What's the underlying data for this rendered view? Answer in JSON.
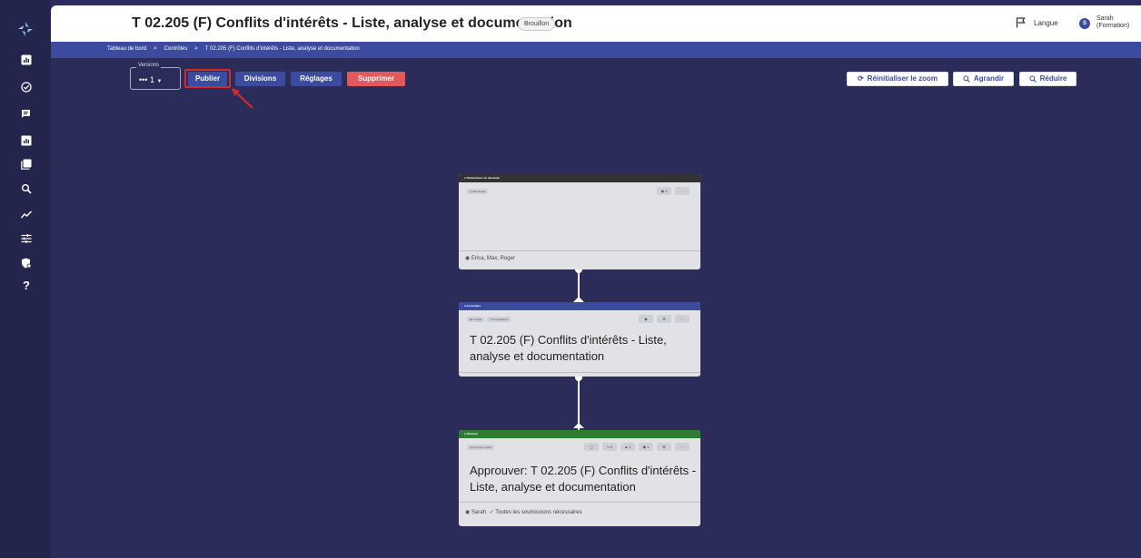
{
  "header": {
    "title": "T 02.205 (F) Conflits d'intérêts - Liste, analyse et documentation",
    "status_badge": "Brouillon",
    "language_label": "Langue",
    "user_initial": "S",
    "user_name": "Sarah",
    "user_role": "(Formation)"
  },
  "breadcrumb": {
    "items": [
      "Tableau de bord",
      "Contrôles",
      "T 02.205 (F) Conflits d'intérêts - Liste, analyse et documentation"
    ],
    "separator": ">"
  },
  "toolbar": {
    "versions_label": "Versions",
    "version_value": "1",
    "publish_label": "Publier",
    "divisions_label": "Divisions",
    "settings_label": "Réglages",
    "delete_label": "Supprimer",
    "reset_zoom_label": "Réinitialiser le zoom",
    "zoom_in_label": "Agrandir",
    "zoom_out_label": "Réduire"
  },
  "sidebar": {
    "icons": [
      "dashboard-icon",
      "check-circle-icon",
      "chat-icon",
      "report-icon",
      "library-icon",
      "search-icon",
      "trend-icon",
      "sliders-icon",
      "shield-icon",
      "help-icon"
    ]
  },
  "workflow": {
    "node1": {
      "header": "Déclencheur de demande",
      "tag": "Demander",
      "count": "3",
      "more": "···",
      "footer": "Erica, Max, Roger"
    },
    "node2": {
      "header": "Formulaire",
      "tag1": "1 Page",
      "tag2": "11 Questions",
      "more": "···",
      "title": "T 02.205 (F) Conflits d'intérêts - Liste, analyse et documentation"
    },
    "node3": {
      "header": "Décision",
      "tag": "Peut être rejeté",
      "count_a": "0",
      "count_b": "1",
      "count_c": "1",
      "more": "···",
      "title": "Approuver: T 02.205 (F) Conflits d'intérêts - Liste, analyse et documentation",
      "footer_user": "Sarah",
      "footer_note": "Toutes les soumissions nécessaires"
    }
  },
  "colors": {
    "canvas": "#2b2c5a",
    "sidebar": "#24254d",
    "accent_blue": "#3a4ba0",
    "delete_red": "#e4585c",
    "form_header": "#3d4b9f",
    "decision_header": "#2e7d32",
    "trigger_header": "#333333",
    "highlight_red": "#d52a2a"
  }
}
